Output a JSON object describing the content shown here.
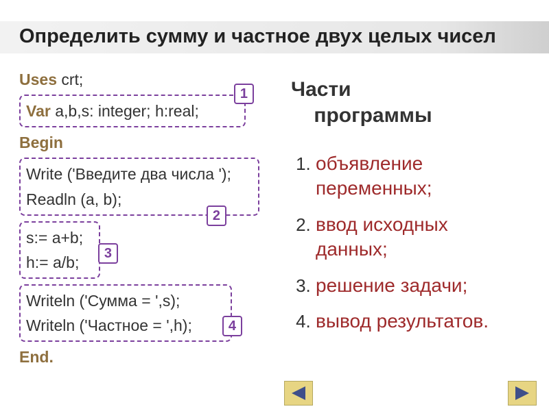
{
  "title": "Определить сумму и частное двух целых чисел",
  "code": {
    "uses_kw": "Uses",
    "uses_rest": " crt;",
    "var_kw": "Var",
    "var_rest": " a,b,s: integer; h:real;",
    "begin_kw": "Begin",
    "write_prompt": "Write ('Введите два числа ');",
    "readln": "Readln (a, b);",
    "calc1": "s:= a+b;",
    "calc2": "h:= a/b;",
    "out1": "Writeln ('Сумма = ',s);",
    "out2": "Writeln ('Частное = ',h);",
    "end_kw": "End."
  },
  "tags": {
    "t1": "1",
    "t2": "2",
    "t3": "3",
    "t4": "4"
  },
  "right": {
    "heading_line1": "Части",
    "heading_line2": "программы",
    "items": [
      "объявление переменных;",
      "ввод исходных данных;",
      "решение задачи;",
      "вывод результатов."
    ]
  }
}
